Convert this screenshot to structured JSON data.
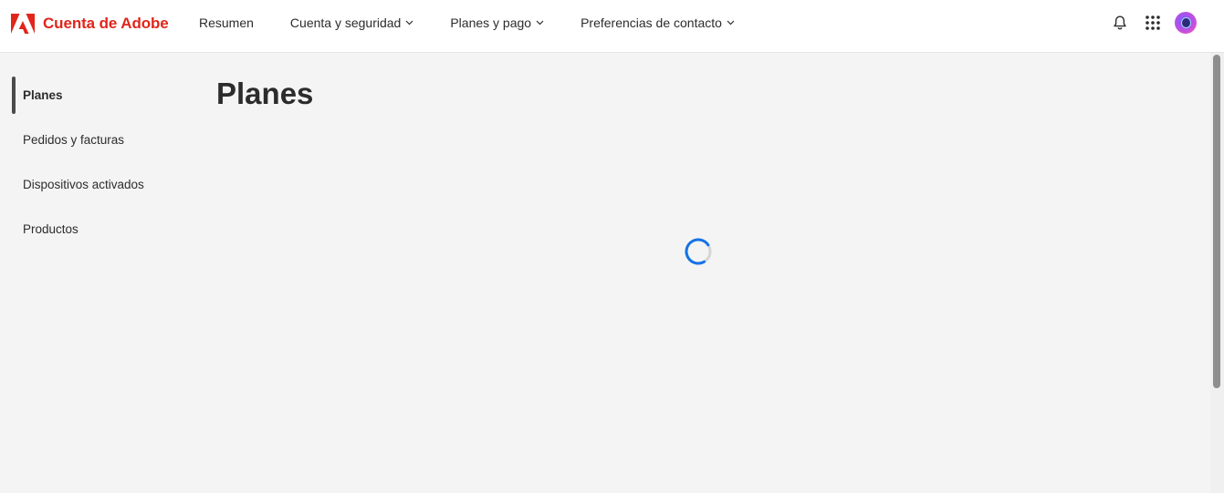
{
  "header": {
    "brand": "Cuenta de Adobe",
    "nav": [
      {
        "label": "Resumen"
      },
      {
        "label": "Cuenta y seguridad"
      },
      {
        "label": "Planes y pago"
      },
      {
        "label": "Preferencias de contacto"
      }
    ],
    "icons": [
      "bell-icon",
      "apps-grid-icon",
      "avatar"
    ]
  },
  "sidebar": {
    "items": [
      {
        "label": "Planes",
        "active": true
      },
      {
        "label": "Pedidos y facturas"
      },
      {
        "label": "Dispositivos activados"
      },
      {
        "label": "Productos"
      }
    ]
  },
  "main": {
    "title": "Planes",
    "loading": true
  },
  "colors": {
    "brand": "#e1251b",
    "spinner": "#1473e6",
    "background": "#f4f4f4"
  }
}
